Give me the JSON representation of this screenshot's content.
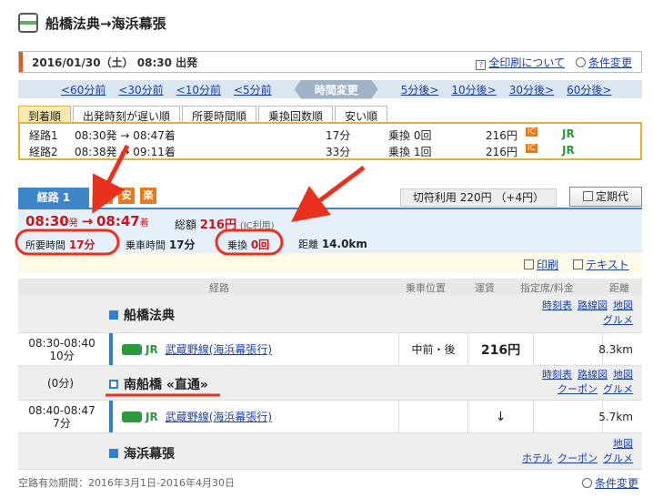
{
  "header": {
    "title": "船橋法典→海浜幕張",
    "icon": "train-icon"
  },
  "datebar": {
    "date": "2016/01/30（土） 08:30 出発",
    "print_all": "全印刷について",
    "change_cond": "条件変更"
  },
  "timenav": {
    "before": [
      "<60分前",
      "<30分前",
      "<10分前",
      "<5分前"
    ],
    "change": "時間変更",
    "after": [
      "5分後>",
      "10分後>",
      "30分後>",
      "60分後>"
    ]
  },
  "sort_tabs": [
    "到着順",
    "出発時刻が遅い順",
    "所要時間順",
    "乗換回数順",
    "安い順"
  ],
  "summary": [
    {
      "route": "経路1",
      "time": "08:30発 → 08:47着",
      "duration": "17分",
      "transfer": "乗換 0回",
      "fare": "216円",
      "ic": "IC",
      "line": "JR"
    },
    {
      "route": "経路2",
      "time": "08:38発 → 09:11着",
      "duration": "33分",
      "transfer": "乗換 1回",
      "fare": "216円",
      "ic": "IC",
      "line": "JR"
    }
  ],
  "route_tab": "経路 1",
  "badges": [
    "早",
    "安",
    "楽"
  ],
  "kiri": "切符利用 220円 （+4円）",
  "teiki": "定期代",
  "route_info": {
    "dep": "08:30",
    "dep_suffix": "発",
    "arrow": "→",
    "arr": "08:47",
    "arr_suffix": "着",
    "total_label": "総額",
    "total": "216円",
    "total_note": "(IC利用)",
    "req_label": "所要時間",
    "req": "17分",
    "ride_label": "乗車時間",
    "ride": "17分",
    "transfer_label": "乗換",
    "transfer": "0回",
    "dist_label": "距離",
    "dist": "14.0km"
  },
  "tools": {
    "print": "印刷",
    "text": "テキスト"
  },
  "table_head": {
    "route": "経路",
    "pos": "乗車位置",
    "fare": "運賃",
    "seat": "指定席/料金",
    "dist": "距離"
  },
  "stations": [
    {
      "name": "船橋法典",
      "links": [
        "時刻表",
        "路線図",
        "地図",
        "グルメ"
      ]
    },
    {
      "name": "南船橋 «直通»",
      "wait": "(0分)",
      "links": [
        "時刻表",
        "路線図",
        "地図",
        "クーポン",
        "グルメ"
      ]
    },
    {
      "name": "海浜幕張",
      "links": [
        "地図",
        "ホテル",
        "クーポン",
        "グルメ"
      ]
    }
  ],
  "segments": [
    {
      "time": "08:30-08:40",
      "dur": "10分",
      "company": "JR",
      "line": "武蔵野線(海浜幕張行)",
      "pos": "中前・後",
      "fare": "216円",
      "dist": "8.3km"
    },
    {
      "time": "08:40-08:47",
      "dur": "7分",
      "company": "JR",
      "line": "武蔵野線(海浜幕張行)",
      "pos": "↓",
      "fare": "",
      "dist": "5.7km"
    }
  ],
  "footer": {
    "validity": "空路有効期間：2016年3月1日-2016年4月30日",
    "change_cond": "条件変更"
  },
  "colors": {
    "accent_red": "#d0121b",
    "route_blue": "#3e86c8",
    "annot_red": "#e8321e"
  }
}
